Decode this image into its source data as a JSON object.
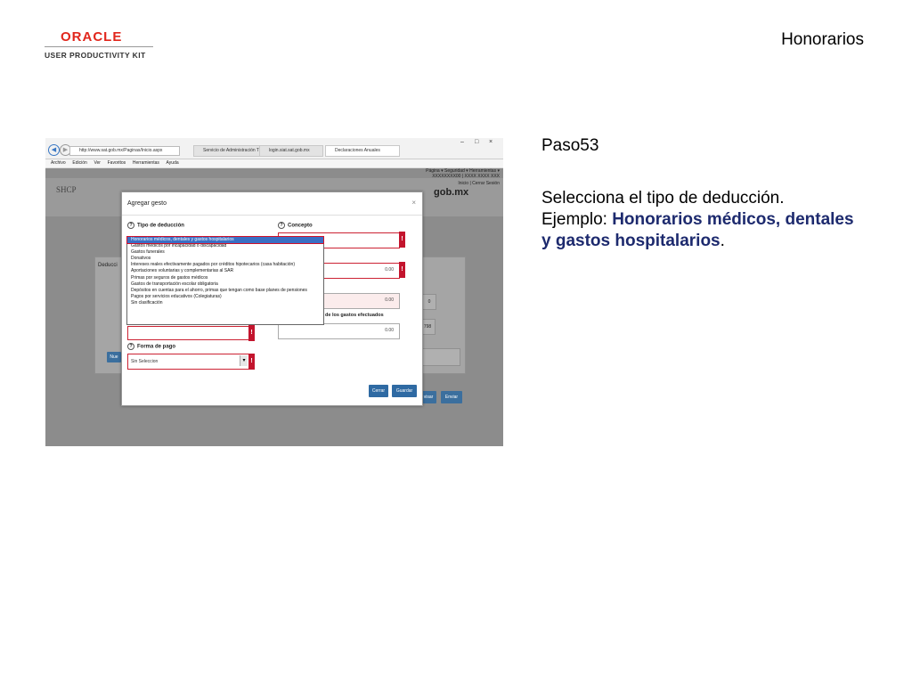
{
  "header": {
    "logo_word": "ORACLE",
    "logo_sub": "USER PRODUCTIVITY KIT",
    "title": "Honorarios"
  },
  "instructions": {
    "step": "Paso53",
    "line1": "Selecciona el tipo de deducción.",
    "example_prefix": "Ejemplo: ",
    "example_highlight": "Honorarios médicos, dentales y gastos hospitalarios",
    "example_suffix": "."
  },
  "browser": {
    "address": "http://www.sat.gob.mx/Paginas/Inicio.aspx",
    "tabs": [
      "Servicio de Administración Tri...",
      "login.siat.sat.gob.mx",
      "Declaraciones Anuales"
    ],
    "menu": [
      "Archivo",
      "Edición",
      "Ver",
      "Favoritos",
      "Herramientas",
      "Ayuda"
    ],
    "commands": "Página ▾  Seguridad ▾  Herramientas ▾",
    "win_controls": [
      "–",
      "□",
      "×"
    ]
  },
  "site": {
    "agency": "SHCP",
    "portal": "gob.mx",
    "user": "XXXXXXXX00 | XXXX XXXX XXX",
    "links": "Inicio | Cerrar Sesión",
    "section_label": "Deducci"
  },
  "modal": {
    "title": "Agregar gesto",
    "close": "×",
    "tipo_label": "Tipo de deducción",
    "concepto_label": "Concepto",
    "monto_label": "de los gastos efectuados",
    "forma_label": "Forma de pago",
    "forma_value": "Sin Seleccion",
    "amount_values": [
      "0.00",
      "0.00",
      "0.00"
    ],
    "cerrar": "Cerrar",
    "guardar": "Guardar",
    "err": "!"
  },
  "dropdown": {
    "options": [
      "Honorarios médicos, dentales y gastos hospitalarios",
      "Gastos médicos por incapacidad o discapacidad",
      "Gastos funerales",
      "Donativos",
      "Intereses reales efectivamente pagados por créditos hipotecarios (casa habitación)",
      "Aportaciones voluntarias y complementarias al SAR",
      "Primas por seguros de gastos médicos",
      "Gastos de transportación escolar obligatoria",
      "Depósitos en cuentas para el ahorro, primas que tengan como base planes de pensiones",
      "Pagos por servicios educativos (Colegiaturas)",
      "Sin clasificación"
    ],
    "selected_index": 0
  },
  "background": {
    "enviar": "Enviar",
    "revisar": "visar",
    "nuevo": "Nue",
    "val0": "0",
    "val798": "798"
  },
  "colors": {
    "highlight_text": "#1d2a6e",
    "error_red": "#c3142d",
    "oracle_red": "#e1261c",
    "button_blue": "#2f6aa3"
  }
}
